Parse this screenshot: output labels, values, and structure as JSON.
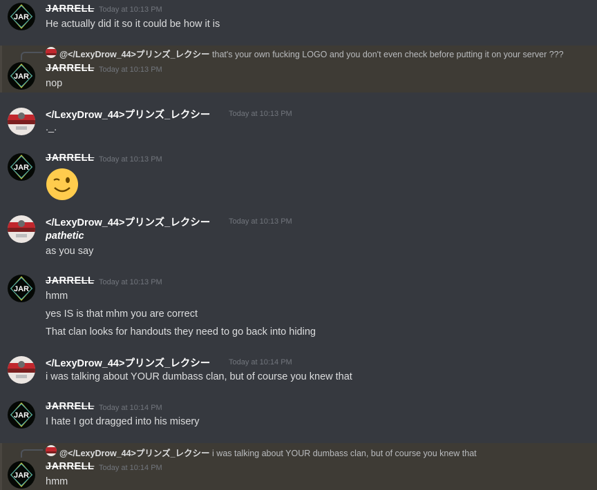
{
  "users": {
    "jar": {
      "name": "JARRELL",
      "avatar_text": "JAR"
    },
    "lexy": {
      "name": "</LexyDrow_44>プリンズ_レクシー"
    }
  },
  "messages": [
    {
      "author": "JARRELL",
      "time": "Today at 10:13 PM",
      "lines": [
        "He actually did it so it could be how it is"
      ]
    },
    {
      "reply_to": "@</LexyDrow_44>プリンズ_レクシー",
      "reply_text": "that's your own fucking LOGO and you don't even check before putting it on your server ???",
      "author": "JARRELL",
      "time": "Today at 10:13 PM",
      "lines": [
        "nop"
      ]
    },
    {
      "author": "</LexyDrow_44>プリンズ_レクシー",
      "time": "Today at 10:13 PM",
      "lines": [
        "._."
      ]
    },
    {
      "author": "JARRELL",
      "time": "Today at 10:13 PM",
      "emoji": "winking-face"
    },
    {
      "author": "</LexyDrow_44>プリンズ_レクシー",
      "time": "Today at 10:13 PM",
      "lines": [
        "pathetic",
        "as you say"
      ]
    },
    {
      "author": "JARRELL",
      "time": "Today at 10:13 PM",
      "lines": [
        "hmm",
        "yes IS is that mhm you are correct",
        "That clan looks for handouts they need to go back into hiding"
      ]
    },
    {
      "author": "</LexyDrow_44>プリンズ_レクシー",
      "time": "Today at 10:14 PM",
      "lines": [
        "i was talking about YOUR dumbass clan, but of course you knew that"
      ]
    },
    {
      "author": "JARRELL",
      "time": "Today at 10:14 PM",
      "lines": [
        "I hate I got dragged into his misery"
      ]
    },
    {
      "reply_to": "@</LexyDrow_44>プリンズ_レクシー",
      "reply_text": "i was talking about YOUR dumbass clan, but of course you knew that",
      "author": "JARRELL",
      "time": "Today at 10:14 PM",
      "lines": [
        "hmm"
      ]
    }
  ],
  "colors": {
    "background": "#36393f",
    "mention_bg": "#3e3b35",
    "timestamp": "#72767d",
    "text": "#dcddde"
  }
}
